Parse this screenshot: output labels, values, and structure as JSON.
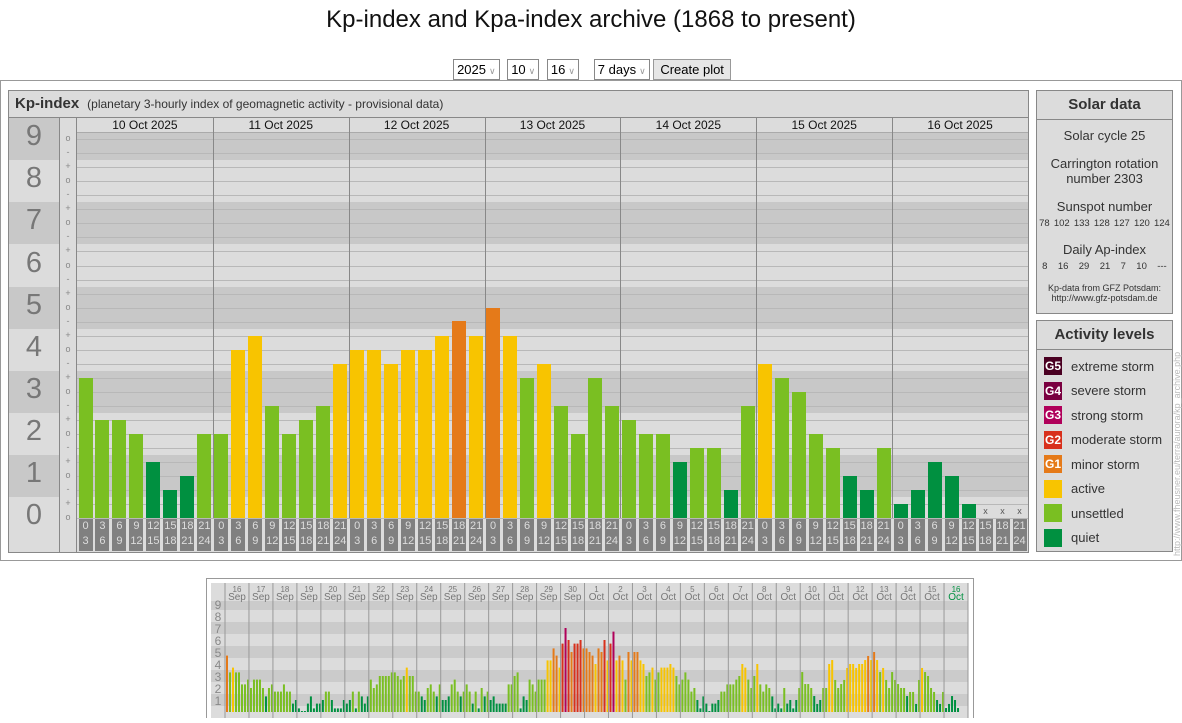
{
  "title": "Kp-index and Kpa-index archive (1868 to present)",
  "controls": {
    "year": "2025",
    "month": "10",
    "day": "16",
    "span": "7 days",
    "create_label": "Create plot"
  },
  "kp_panel": {
    "title": "Kp-index",
    "subtitle": "(planetary 3-hourly index of geomagnetic activity - provisional data)"
  },
  "solar": {
    "title": "Solar data",
    "cycle": "Solar cycle 25",
    "carrington_1": "Carrington rotation",
    "carrington_2": "number 2303",
    "sunspot_label": "Sunspot number",
    "sunspots": [
      "78",
      "102",
      "133",
      "128",
      "127",
      "120",
      "124"
    ],
    "ap_label": "Daily Ap-index",
    "ap": [
      "8",
      "16",
      "29",
      "21",
      "7",
      "10",
      "---"
    ],
    "source_1": "Kp-data from GFZ Potsdam:",
    "source_2": "http://www.gfz-potsdam.de"
  },
  "activity": {
    "title": "Activity levels",
    "levels": [
      {
        "badge": "G5",
        "label": "extreme storm",
        "color": "#4a0022"
      },
      {
        "badge": "G4",
        "label": "severe storm",
        "color": "#7a0040"
      },
      {
        "badge": "G3",
        "label": "strong storm",
        "color": "#b0005a"
      },
      {
        "badge": "G2",
        "label": "moderate storm",
        "color": "#d8301c"
      },
      {
        "badge": "G1",
        "label": "minor storm",
        "color": "#e57a19"
      },
      {
        "badge": "",
        "label": "active",
        "color": "#f8c400"
      },
      {
        "badge": "",
        "label": "unsettled",
        "color": "#7abf22"
      },
      {
        "badge": "",
        "label": "quiet",
        "color": "#009040"
      }
    ]
  },
  "side_url": "http://www.fheusner.eu/terra/aurora/kp_archive.php",
  "chart_data": [
    {
      "type": "bar",
      "title": "Kp-index",
      "ylim": [
        0,
        9
      ],
      "yticks": [
        "0",
        "1",
        "2",
        "3",
        "4",
        "5",
        "6",
        "7",
        "8",
        "9"
      ],
      "subticks": [
        "+",
        "o",
        "-"
      ],
      "missing_marker": "x",
      "time_slots": [
        [
          "0",
          "3"
        ],
        [
          "3",
          "6"
        ],
        [
          "6",
          "9"
        ],
        [
          "9",
          "12"
        ],
        [
          "12",
          "15"
        ],
        [
          "15",
          "18"
        ],
        [
          "18",
          "21"
        ],
        [
          "21",
          "24"
        ]
      ],
      "days": [
        {
          "date": "10 Oct 2025",
          "values": [
            3.33,
            2.33,
            2.33,
            2,
            1.33,
            0.67,
            1,
            2
          ]
        },
        {
          "date": "11 Oct 2025",
          "values": [
            2,
            4,
            4.33,
            2.67,
            2,
            2.33,
            2.67,
            3.67
          ]
        },
        {
          "date": "12 Oct 2025",
          "values": [
            4,
            4,
            3.67,
            4,
            4,
            4.33,
            4.67,
            4.33
          ]
        },
        {
          "date": "13 Oct 2025",
          "values": [
            5,
            4.33,
            3.33,
            3.67,
            2.67,
            2,
            3.33,
            2.67
          ]
        },
        {
          "date": "14 Oct 2025",
          "values": [
            2.33,
            2,
            2,
            1.33,
            1.67,
            1.67,
            0.67,
            2.67
          ]
        },
        {
          "date": "15 Oct 2025",
          "values": [
            3.67,
            3.33,
            3,
            2,
            1.67,
            1,
            0.67,
            1.67
          ]
        },
        {
          "date": "16 Oct 2025",
          "values": [
            0.33,
            0.67,
            1.33,
            1,
            0.33,
            null,
            null,
            null
          ]
        }
      ]
    },
    {
      "type": "bar",
      "title": "",
      "ylim": [
        0,
        9
      ],
      "yticks": [
        "1",
        "2",
        "3",
        "4",
        "5",
        "6",
        "7",
        "8",
        "9"
      ],
      "highlight_color": "#009040",
      "days": [
        {
          "d": "16",
          "m": "Sep",
          "values": [
            4.7,
            3.3,
            3.7,
            3.3,
            3.3,
            2.3,
            2.3,
            2.7
          ]
        },
        {
          "d": "17",
          "m": "Sep",
          "values": [
            2,
            2.7,
            2.7,
            2.7,
            2,
            1.3,
            2,
            2.3
          ]
        },
        {
          "d": "18",
          "m": "Sep",
          "values": [
            1.7,
            1.7,
            1.7,
            2.3,
            1.7,
            1.7,
            0.7,
            1
          ]
        },
        {
          "d": "19",
          "m": "Sep",
          "values": [
            0.3,
            0,
            0,
            0.7,
            1.3,
            0.3,
            0.7,
            0.7
          ]
        },
        {
          "d": "20",
          "m": "Sep",
          "values": [
            1,
            1.7,
            1.7,
            1,
            0.3,
            0.3,
            0.3,
            1
          ]
        },
        {
          "d": "21",
          "m": "Sep",
          "values": [
            0.7,
            1,
            1.7,
            0.3,
            1.7,
            1.3,
            0.7,
            1.3
          ]
        },
        {
          "d": "22",
          "m": "Sep",
          "values": [
            2.7,
            2,
            2.3,
            3,
            3,
            3,
            3,
            3.3
          ]
        },
        {
          "d": "23",
          "m": "Sep",
          "values": [
            3.3,
            3,
            2.7,
            3,
            3.7,
            3,
            3,
            1.7
          ]
        },
        {
          "d": "24",
          "m": "Sep",
          "values": [
            1.7,
            1.3,
            1,
            2,
            2.3,
            1.7,
            1.3,
            2.3
          ]
        },
        {
          "d": "25",
          "m": "Sep",
          "values": [
            1,
            1,
            1.3,
            2.3,
            2.7,
            1.7,
            1.3,
            1.7
          ]
        },
        {
          "d": "26",
          "m": "Sep",
          "values": [
            2.3,
            1.7,
            0.7,
            1.7,
            0.3,
            2,
            1.3,
            1.7
          ]
        },
        {
          "d": "27",
          "m": "Sep",
          "values": [
            1,
            1.3,
            0.7,
            0.7,
            0.7,
            0.7,
            2.3,
            2.3
          ]
        },
        {
          "d": "28",
          "m": "Sep",
          "values": [
            3,
            3.3,
            0.3,
            1.3,
            1,
            2.7,
            2.3,
            1.7
          ]
        },
        {
          "d": "29",
          "m": "Sep",
          "values": [
            2.7,
            2.7,
            2.7,
            4.3,
            4.3,
            5.3,
            4.7,
            3.7
          ]
        },
        {
          "d": "30",
          "m": "Sep",
          "values": [
            5.7,
            7,
            6,
            5,
            5.7,
            5.7,
            6,
            5.3
          ]
        },
        {
          "d": "1",
          "m": "Oct",
          "values": [
            5.3,
            5,
            4.7,
            4,
            5.3,
            5,
            6,
            4.3
          ]
        },
        {
          "d": "2",
          "m": "Oct",
          "values": [
            5.7,
            6.7,
            4.3,
            4.7,
            4.3,
            2.7,
            5,
            4.3
          ]
        },
        {
          "d": "3",
          "m": "Oct",
          "values": [
            5,
            5,
            4.3,
            4,
            3,
            3.3,
            3.7,
            2.7
          ]
        },
        {
          "d": "4",
          "m": "Oct",
          "values": [
            3.3,
            3.7,
            3.7,
            3.7,
            4,
            3.7,
            3,
            2.3
          ]
        },
        {
          "d": "5",
          "m": "Oct",
          "values": [
            2.7,
            3.3,
            2.7,
            1.7,
            2,
            1,
            0.3,
            1.3
          ]
        },
        {
          "d": "6",
          "m": "Oct",
          "values": [
            0.7,
            0,
            0.7,
            0.7,
            1,
            1.7,
            1.7,
            2.3
          ]
        },
        {
          "d": "7",
          "m": "Oct",
          "values": [
            2.3,
            2.3,
            2.7,
            3,
            4,
            3.7,
            2.7,
            2
          ]
        },
        {
          "d": "8",
          "m": "Oct",
          "values": [
            3,
            4,
            2.3,
            1.7,
            2.3,
            2,
            1.3,
            0.3
          ]
        },
        {
          "d": "9",
          "m": "Oct",
          "values": [
            0.7,
            0.3,
            2,
            0.7,
            1,
            0.3,
            1,
            2
          ]
        },
        {
          "d": "10",
          "m": "Oct",
          "values": [
            3.33,
            2.33,
            2.33,
            2,
            1.33,
            0.67,
            1,
            2
          ]
        },
        {
          "d": "11",
          "m": "Oct",
          "values": [
            2,
            4,
            4.33,
            2.67,
            2,
            2.33,
            2.67,
            3.67
          ]
        },
        {
          "d": "12",
          "m": "Oct",
          "values": [
            4,
            4,
            3.67,
            4,
            4,
            4.33,
            4.67,
            4.33
          ]
        },
        {
          "d": "13",
          "m": "Oct",
          "values": [
            5,
            4.33,
            3.33,
            3.67,
            2.67,
            2,
            3.33,
            2.67
          ]
        },
        {
          "d": "14",
          "m": "Oct",
          "values": [
            2.33,
            2,
            2,
            1.33,
            1.67,
            1.67,
            0.67,
            2.67
          ]
        },
        {
          "d": "15",
          "m": "Oct",
          "values": [
            3.67,
            3.33,
            3,
            2,
            1.67,
            1,
            0.67,
            1.67
          ]
        },
        {
          "d": "16",
          "m": "Oct",
          "values": [
            0.33,
            0.67,
            1.33,
            1,
            0.33,
            null,
            null,
            null
          ]
        }
      ]
    }
  ]
}
